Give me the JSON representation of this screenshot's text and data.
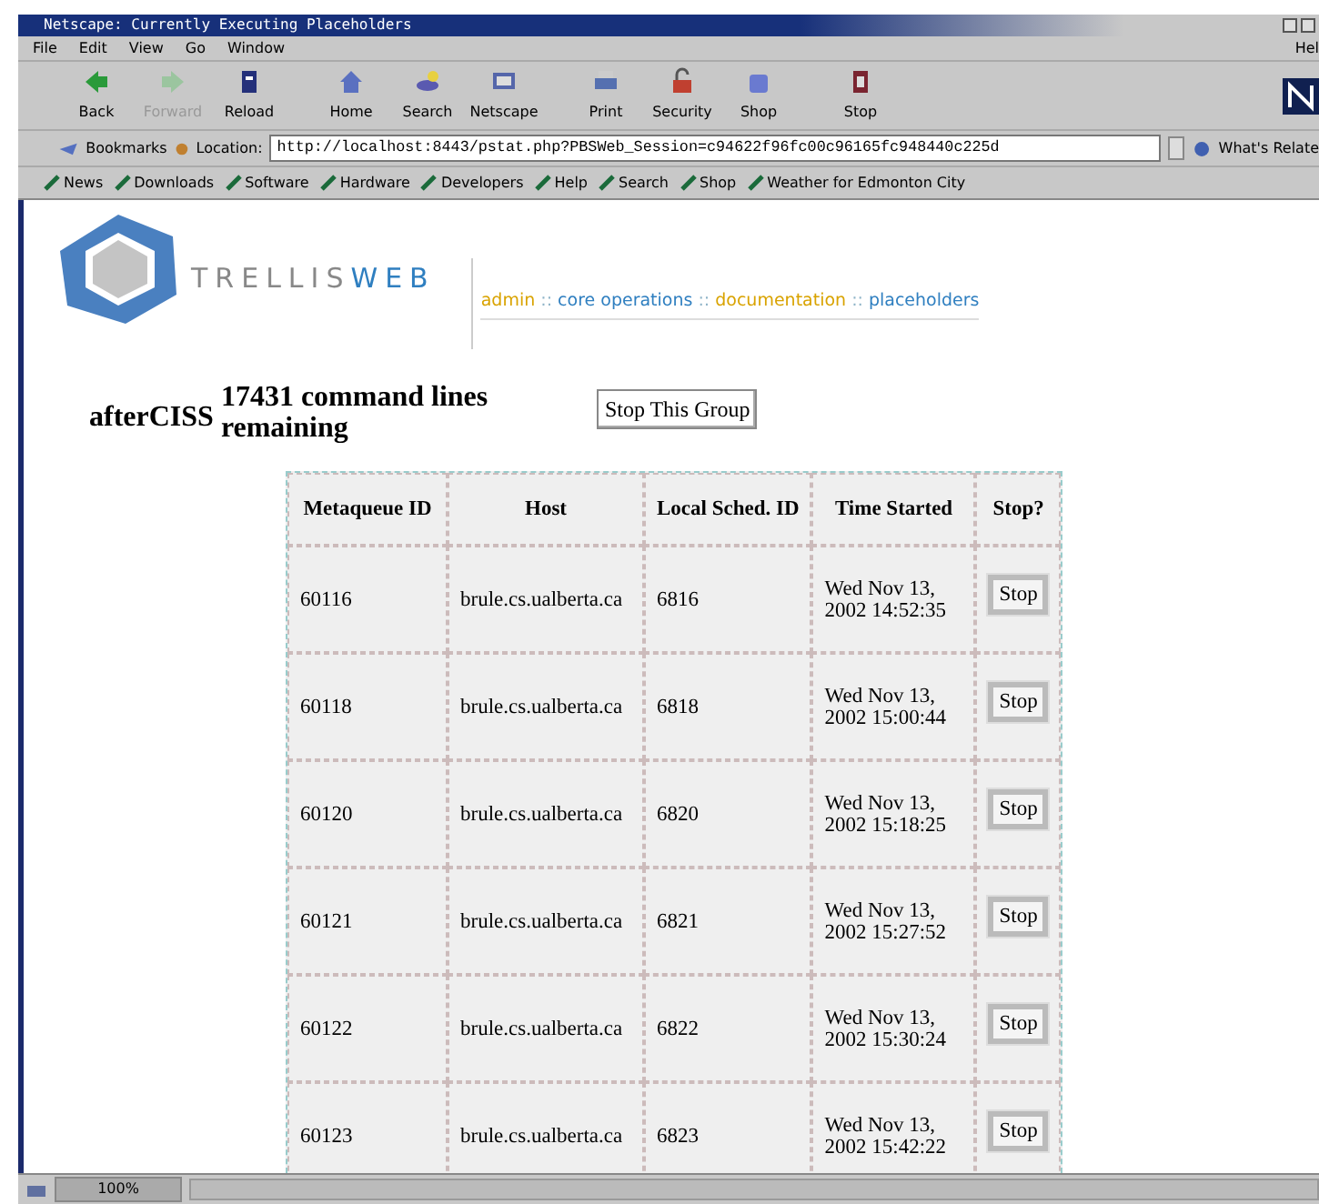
{
  "window": {
    "title": "Netscape: Currently Executing Placeholders"
  },
  "menu": [
    "File",
    "Edit",
    "View",
    "Go",
    "Window",
    "Hel"
  ],
  "toolbar": [
    {
      "label": "Back",
      "disabled": false
    },
    {
      "label": "Forward",
      "disabled": true
    },
    {
      "label": "Reload",
      "disabled": false
    },
    {
      "label": "Home",
      "disabled": false
    },
    {
      "label": "Search",
      "disabled": false
    },
    {
      "label": "Netscape",
      "disabled": false
    },
    {
      "label": "Print",
      "disabled": false
    },
    {
      "label": "Security",
      "disabled": false
    },
    {
      "label": "Shop",
      "disabled": false
    },
    {
      "label": "Stop",
      "disabled": false
    }
  ],
  "location_bar": {
    "bookmarks": "Bookmarks",
    "label": "Location:",
    "url": "http://localhost:8443/pstat.php?PBSWeb_Session=c94622f96fc00c96165fc948440c225d",
    "whats_related": "What's Relate"
  },
  "personal_toolbar": [
    "News",
    "Downloads",
    "Software",
    "Hardware",
    "Developers",
    "Help",
    "Search",
    "Shop",
    "Weather for Edmonton City"
  ],
  "page": {
    "logo": {
      "text_light": "TRELLIS",
      "text_strong": "WEB"
    },
    "nav": [
      {
        "kind": "link",
        "label": "admin",
        "color": "#d9a300"
      },
      {
        "kind": "separator",
        "label": "::",
        "color": "#8fb4c8"
      },
      {
        "kind": "link",
        "label": "core operations",
        "color": "#2f7fc0"
      },
      {
        "kind": "separator",
        "label": "::",
        "color": "#8fb4c8"
      },
      {
        "kind": "link",
        "label": "documentation",
        "color": "#d9a300"
      },
      {
        "kind": "separator",
        "label": "::",
        "color": "#8fb4c8"
      },
      {
        "kind": "link",
        "label": "placeholders",
        "color": "#2f7fc0"
      }
    ],
    "group": {
      "name": "afterCISS",
      "status": "17431 command lines remaining",
      "button": "Stop This Group"
    },
    "table": {
      "columns": [
        "Metaqueue ID",
        "Host",
        "Local Sched. ID",
        "Time Started",
        "Stop?"
      ],
      "rows": [
        {
          "metaqueue_id": "60116",
          "host": "brule.cs.ualberta.ca",
          "local_sched_id": "6816",
          "time_started": "Wed Nov 13, 2002 14:52:35",
          "stop": "Stop"
        },
        {
          "metaqueue_id": "60118",
          "host": "brule.cs.ualberta.ca",
          "local_sched_id": "6818",
          "time_started": "Wed Nov 13, 2002 15:00:44",
          "stop": "Stop"
        },
        {
          "metaqueue_id": "60120",
          "host": "brule.cs.ualberta.ca",
          "local_sched_id": "6820",
          "time_started": "Wed Nov 13, 2002 15:18:25",
          "stop": "Stop"
        },
        {
          "metaqueue_id": "60121",
          "host": "brule.cs.ualberta.ca",
          "local_sched_id": "6821",
          "time_started": "Wed Nov 13, 2002 15:27:52",
          "stop": "Stop"
        },
        {
          "metaqueue_id": "60122",
          "host": "brule.cs.ualberta.ca",
          "local_sched_id": "6822",
          "time_started": "Wed Nov 13, 2002 15:30:24",
          "stop": "Stop"
        },
        {
          "metaqueue_id": "60123",
          "host": "brule.cs.ualberta.ca",
          "local_sched_id": "6823",
          "time_started": "Wed Nov 13, 2002 15:42:22",
          "stop": "Stop"
        }
      ]
    }
  },
  "status_bar": {
    "zoom": "100%"
  }
}
